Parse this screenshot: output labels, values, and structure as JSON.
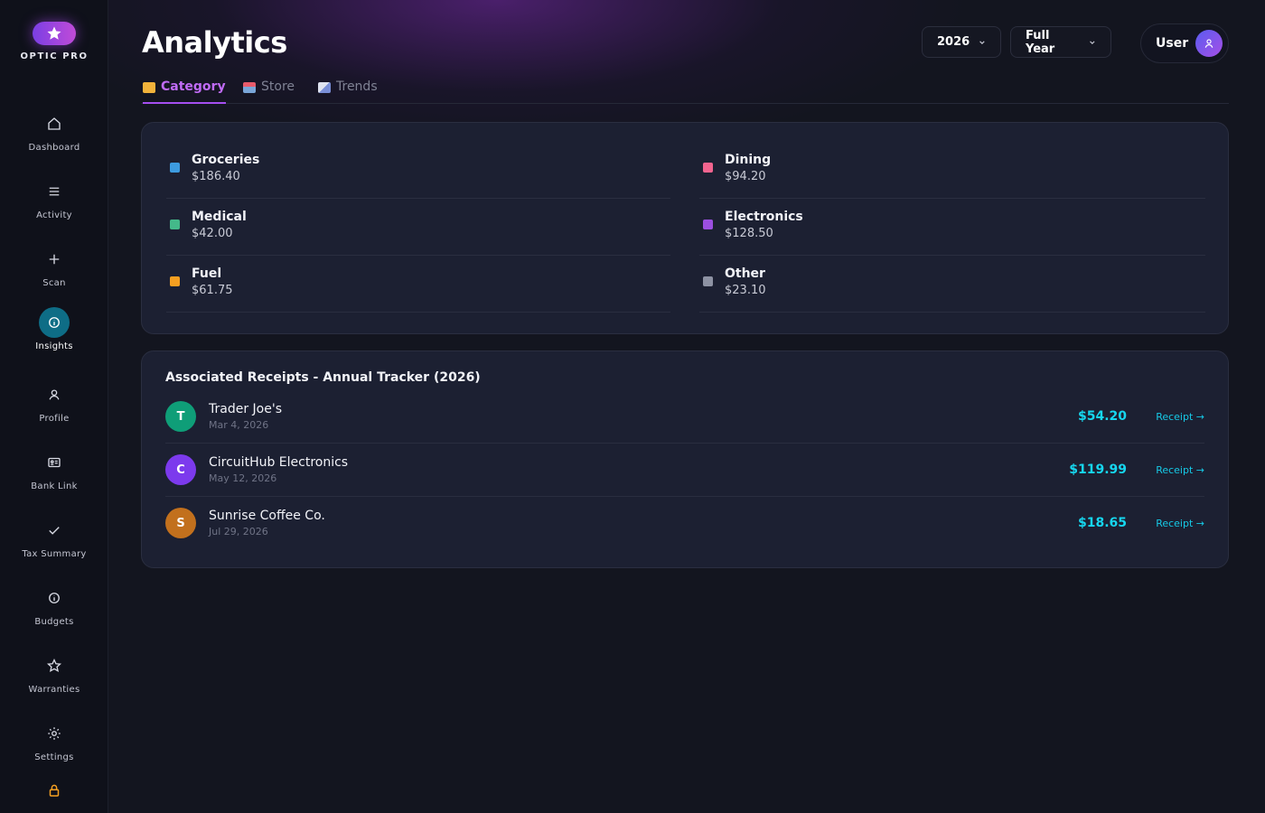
{
  "brand": {
    "name": "OPTIC PRO"
  },
  "sidebar": {
    "items": [
      {
        "label": "Dashboard",
        "icon": "home-icon",
        "active": false
      },
      {
        "label": "Activity",
        "icon": "list-icon",
        "active": false
      },
      {
        "label": "Scan",
        "icon": "plus-icon",
        "active": false
      },
      {
        "label": "Insights",
        "icon": "info-icon",
        "active": true
      },
      {
        "label": "Profile",
        "icon": "user-icon",
        "active": false
      },
      {
        "label": "Bank Link",
        "icon": "id-card-icon",
        "active": false
      },
      {
        "label": "Tax Summary",
        "icon": "checkmark-icon",
        "active": false
      },
      {
        "label": "Budgets",
        "icon": "info-icon",
        "active": false
      },
      {
        "label": "Warranties",
        "icon": "star-icon",
        "active": false
      },
      {
        "label": "Settings",
        "icon": "gear-icon",
        "active": false
      }
    ],
    "footer_icon": "lock-icon"
  },
  "header": {
    "title": "Analytics",
    "year_select": "2026",
    "period_select": "Full Year",
    "user": {
      "name": "User",
      "icon": "user-icon"
    }
  },
  "tabs": [
    {
      "label": "Category",
      "icon": "folder-icon",
      "active": true
    },
    {
      "label": "Store",
      "icon": "store-icon",
      "active": false
    },
    {
      "label": "Trends",
      "icon": "chart-icon",
      "active": false
    }
  ],
  "categories": [
    {
      "name": "Groceries",
      "amount": "$186.40",
      "color": "#3d9be0"
    },
    {
      "name": "Dining",
      "amount": "$94.20",
      "color": "#f2648f"
    },
    {
      "name": "Medical",
      "amount": "$42.00",
      "color": "#44b98a"
    },
    {
      "name": "Electronics",
      "amount": "$128.50",
      "color": "#9b4fe0"
    },
    {
      "name": "Fuel",
      "amount": "$61.75",
      "color": "#f59f21"
    },
    {
      "name": "Other",
      "amount": "$23.10",
      "color": "#8d92a3"
    }
  ],
  "receipts": {
    "title": "Associated Receipts - Annual Tracker (2026)",
    "link_label": "Receipt →",
    "items": [
      {
        "initial": "T",
        "merchant": "Trader Joe's",
        "date": "Mar 4, 2026",
        "amount": "$54.20",
        "avatar_color": "#0f9e78"
      },
      {
        "initial": "C",
        "merchant": "CircuitHub Electronics",
        "date": "May 12, 2026",
        "amount": "$119.99",
        "avatar_color": "#7c3aed"
      },
      {
        "initial": "S",
        "merchant": "Sunrise Coffee Co.",
        "date": "Jul 29, 2026",
        "amount": "$18.65",
        "avatar_color": "#c2701d"
      }
    ]
  },
  "colors": {
    "accent_purple": "#a54ef0",
    "accent_cyan": "#16d6ee",
    "active_nav": "#0e6d86"
  }
}
